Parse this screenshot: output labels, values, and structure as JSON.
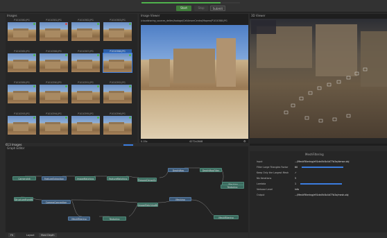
{
  "toolbar": {
    "progress": 0.8,
    "start_label": "Start",
    "stop_label": "Stop",
    "submit_label": "Submit"
  },
  "images_panel": {
    "title": "Images",
    "thumbnails": [
      {
        "name": "P1010380.JPG",
        "status": "green"
      },
      {
        "name": "P1010381.JPG",
        "status": "red"
      },
      {
        "name": "P1010382.JPG",
        "status": "green"
      },
      {
        "name": "P1010383.JPG",
        "status": "green"
      },
      {
        "name": "P1010385.JPG",
        "status": "green"
      },
      {
        "name": "P1010386.JPG",
        "status": "green"
      },
      {
        "name": "P1010387.JPG",
        "status": "green"
      },
      {
        "name": "P1010388.JPG",
        "status": "green",
        "selected": true
      },
      {
        "name": "P1010389.JPG",
        "status": "green"
      },
      {
        "name": "P1010390.JPG",
        "status": "green"
      },
      {
        "name": "P1010391.JPG",
        "status": "green"
      },
      {
        "name": "P1010392.JPG",
        "status": "green"
      },
      {
        "name": "P1010393.JPG",
        "status": "green"
      },
      {
        "name": "P1010394.JPG",
        "status": "green"
      },
      {
        "name": "P1010395.JPG",
        "status": "green"
      },
      {
        "name": "P1010396.JPG",
        "status": "green"
      }
    ],
    "footer_label": "613 Images"
  },
  "image_viewer": {
    "title": "Image Viewer",
    "path": "/cloudsharing_sources_deltes/footage/CellAmoreCentro/Mapero/P1010388.JPG",
    "footer_zoom": "0.15x",
    "footer_dims": "4272x2848"
  },
  "viewer_3d": {
    "title": "3D Viewer"
  },
  "graph_editor": {
    "title": "Graph Editor",
    "nodes": [
      {
        "label": "CameraInit"
      },
      {
        "label": "FeatureExtraction"
      },
      {
        "label": "ImageMatching"
      },
      {
        "label": "FeatureMatching"
      },
      {
        "label": "CameraConnection"
      },
      {
        "label": "StructureFromMotion"
      },
      {
        "label": "PrepareDenseScene"
      },
      {
        "label": "DepthMap"
      },
      {
        "label": "DepthMapFilter"
      },
      {
        "label": "Meshing"
      },
      {
        "label": "MeshFiltering"
      },
      {
        "label": "Texturing"
      },
      {
        "label": "ImageMatchingMultiSfM"
      },
      {
        "label": "Meshing"
      },
      {
        "label": "MeshFiltering"
      },
      {
        "label": "Texturing"
      }
    ],
    "footer_fit": "Fit",
    "footer_layout_label": "Layout",
    "footer_layout_value": "Most Depth"
  },
  "attribute_editor": {
    "title": "MeshFiltering",
    "rows": [
      {
        "label": "Input",
        "value": ".../MeshFiltering/e91de4fc8c4d77b3a/dense.obj"
      },
      {
        "label": "Filter Large Triangles Factor",
        "value": "60"
      },
      {
        "label": "Keep Only the Largest Mesh",
        "value": "✓"
      },
      {
        "label": "Nb Iterations",
        "value": "5"
      },
      {
        "label": "Lambda",
        "value": "1"
      },
      {
        "label": "Verbose Level",
        "value": "info"
      },
      {
        "label": "Output",
        "value": ".../MeshFiltering/e91de4fc8c4d77b3a/mesh.obj"
      }
    ]
  },
  "colors": {
    "accent_green": "#4fb34c",
    "selection_blue": "#3b7de0",
    "node_teal": "#3b6a5e"
  }
}
